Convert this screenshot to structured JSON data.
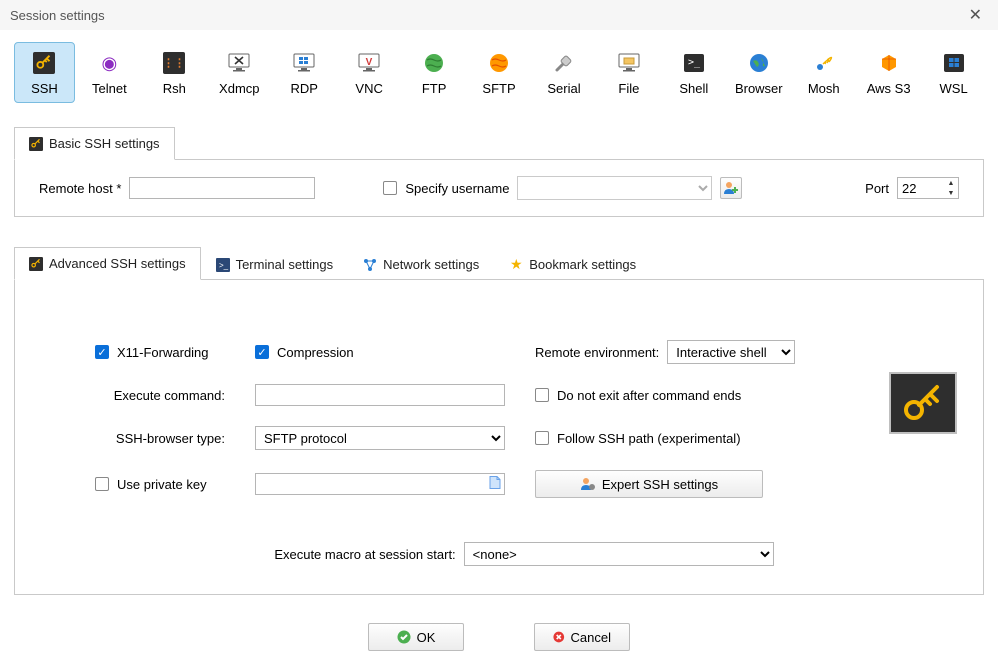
{
  "window": {
    "title": "Session settings"
  },
  "protocols": [
    {
      "label": "SSH"
    },
    {
      "label": "Telnet"
    },
    {
      "label": "Rsh"
    },
    {
      "label": "Xdmcp"
    },
    {
      "label": "RDP"
    },
    {
      "label": "VNC"
    },
    {
      "label": "FTP"
    },
    {
      "label": "SFTP"
    },
    {
      "label": "Serial"
    },
    {
      "label": "File"
    },
    {
      "label": "Shell"
    },
    {
      "label": "Browser"
    },
    {
      "label": "Mosh"
    },
    {
      "label": "Aws S3"
    },
    {
      "label": "WSL"
    }
  ],
  "basicTab": {
    "title": "Basic SSH settings"
  },
  "basic": {
    "remote_host_label": "Remote host *",
    "remote_host_value": "",
    "specify_username_label": "Specify username",
    "username_value": "",
    "port_label": "Port",
    "port_value": "22"
  },
  "advTabs": {
    "advanced": "Advanced SSH settings",
    "terminal": "Terminal settings",
    "network": "Network settings",
    "bookmark": "Bookmark settings"
  },
  "adv": {
    "x11_label": "X11-Forwarding",
    "compression_label": "Compression",
    "remote_env_label": "Remote environment:",
    "remote_env_value": "Interactive shell",
    "exec_cmd_label": "Execute command:",
    "exec_cmd_value": "",
    "no_exit_label": "Do not exit after command ends",
    "ssh_browser_label": "SSH-browser type:",
    "ssh_browser_value": "SFTP protocol",
    "follow_path_label": "Follow SSH path (experimental)",
    "priv_key_label": "Use private key",
    "priv_key_value": "",
    "expert_btn": "Expert SSH settings",
    "macro_label": "Execute macro at session start:",
    "macro_value": "<none>"
  },
  "buttons": {
    "ok": "OK",
    "cancel": "Cancel"
  }
}
